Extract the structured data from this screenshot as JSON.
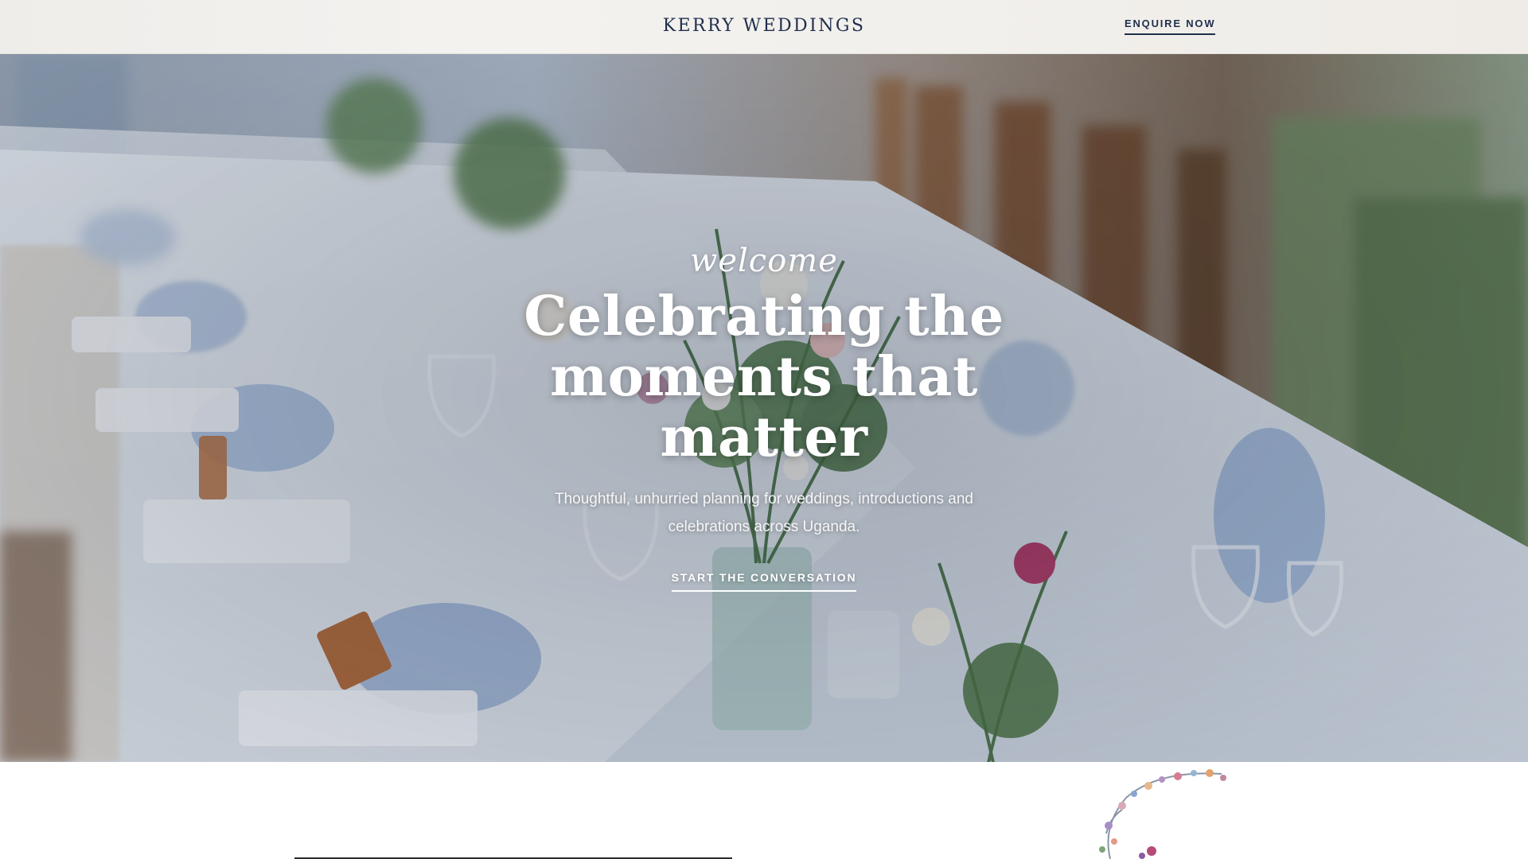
{
  "header": {
    "brand": "KERRY WEDDINGS",
    "enquire_label": "ENQUIRE NOW"
  },
  "hero": {
    "script_text": "welcome",
    "headline": "Celebrating the moments that matter",
    "subhead": "Thoughtful, unhurried planning for weddings, introductions and celebrations across Uganda.",
    "cta_label": "START THE CONVERSATION",
    "image_description_icon": "wedding-table-photo"
  },
  "colors": {
    "brand_navy": "#1f2f4d",
    "header_bg": "#f2f0ec",
    "hero_text": "#ffffff"
  }
}
